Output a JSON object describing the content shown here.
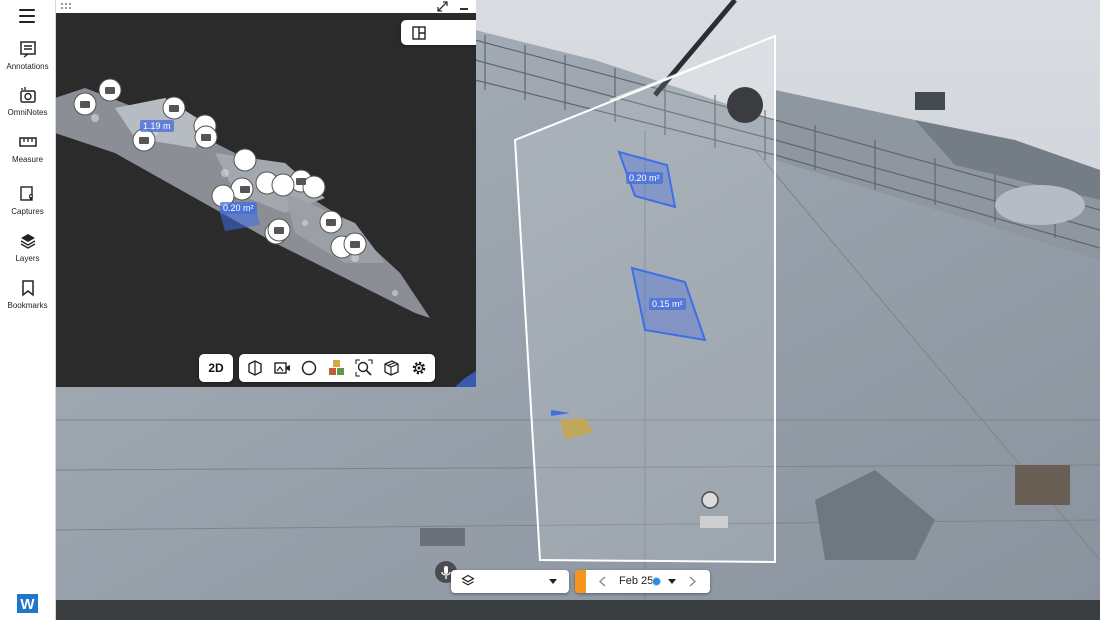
{
  "sidebar": {
    "menu_icon": "hamburger-menu-icon",
    "items": [
      {
        "label": "Annotations",
        "icon": "annotation-icon"
      },
      {
        "label": "OmniNotes",
        "icon": "camera-note-icon"
      },
      {
        "label": "Measure",
        "icon": "ruler-icon"
      },
      {
        "label": "Captures",
        "icon": "capture-pin-icon"
      },
      {
        "label": "Layers",
        "icon": "layers-icon"
      },
      {
        "label": "Bookmarks",
        "icon": "bookmark-icon"
      }
    ],
    "brand_icon": "w-logo-icon",
    "brand_letter": "W"
  },
  "minimap": {
    "measure_labels": [
      "1.19 m",
      "0.20 m²"
    ],
    "view_dropdown_icon": "split-view-icon",
    "toggle_icon": "eye-off-icon",
    "toolbar": {
      "mode_label": "2D",
      "tools": [
        "box-icon",
        "video-capture-icon",
        "circle-icon",
        "cubes-icon",
        "zoom-scan-icon",
        "package-icon",
        "gear-icon"
      ]
    }
  },
  "scene": {
    "area_labels": [
      "0.20 m²",
      "0.15 m²"
    ]
  },
  "timeline": {
    "layers_icon": "layers-icon",
    "date": "Feb 25"
  },
  "colors": {
    "accent_orange": "#f7941d",
    "measure_blue": "#3e6fe6",
    "brand_blue": "#1f77c9"
  }
}
